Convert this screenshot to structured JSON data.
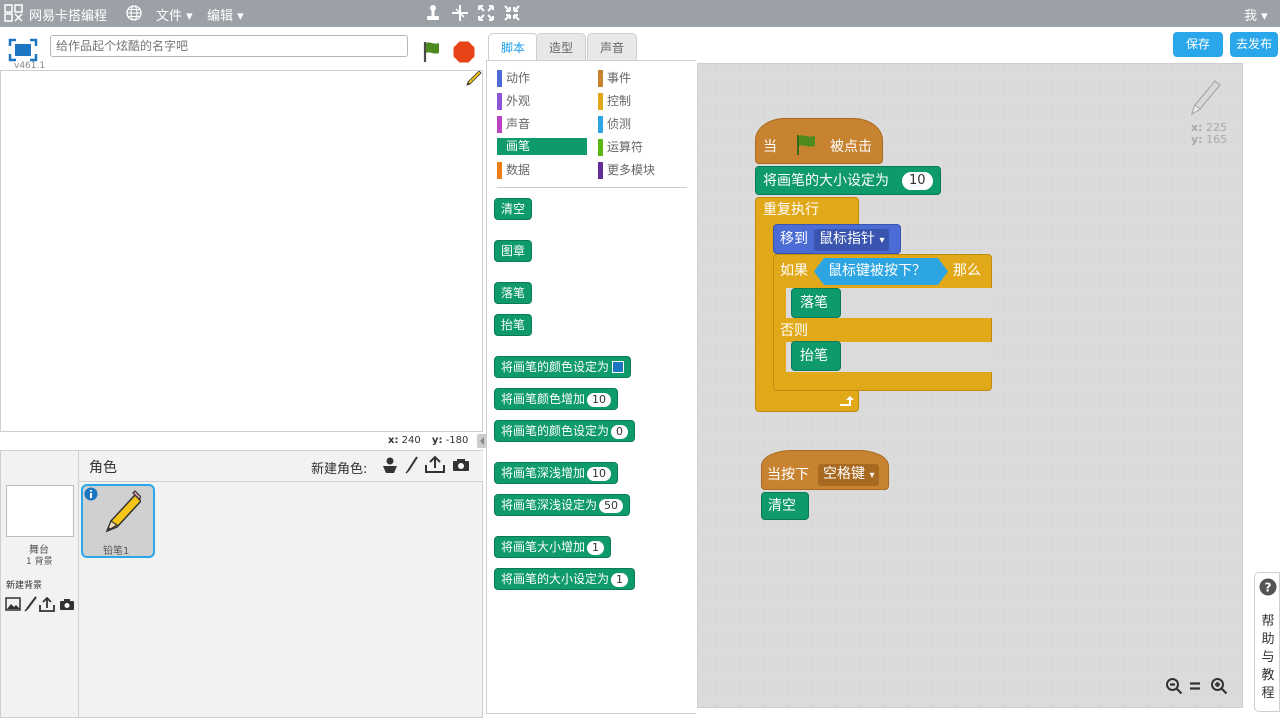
{
  "topbar": {
    "app_title": "网易卡搭编程",
    "menu_file": "文件",
    "menu_edit": "编辑",
    "user": "我"
  },
  "stage": {
    "version": "v461.1",
    "title_placeholder": "给作品起个炫酷的名字吧",
    "coord_x_label": "x:",
    "coord_x": "240",
    "coord_y_label": "y:",
    "coord_y": "-180"
  },
  "sprites": {
    "header": "角色",
    "new_sprite": "新建角色:",
    "stage_label": "舞台",
    "stage_backdrops": "1 背景",
    "new_backdrop": "新建背景",
    "sprite_name": "铅笔1"
  },
  "tabs": [
    "脚本",
    "造型",
    "声音"
  ],
  "actions": {
    "save": "保存",
    "publish": "去发布"
  },
  "categories": [
    {
      "label": "动作",
      "color": "#4a6cd4"
    },
    {
      "label": "事件",
      "color": "#c88330"
    },
    {
      "label": "外观",
      "color": "#8a55d7"
    },
    {
      "label": "控制",
      "color": "#e1a91a"
    },
    {
      "label": "声音",
      "color": "#bb42c3"
    },
    {
      "label": "侦测",
      "color": "#2ca5e2"
    },
    {
      "label": "画笔",
      "color": "#0e9a6c"
    },
    {
      "label": "运算符",
      "color": "#5cb712"
    },
    {
      "label": "数据",
      "color": "#ee7d16"
    },
    {
      "label": "更多模块",
      "color": "#632d99"
    }
  ],
  "palette_blocks": [
    {
      "text": "清空"
    },
    {
      "text": "图章"
    },
    {
      "text": "落笔"
    },
    {
      "text": "抬笔"
    },
    {
      "text": "将画笔的颜色设定为"
    },
    {
      "text": "将画笔颜色增加",
      "value": "10"
    },
    {
      "text": "将画笔的颜色设定为",
      "value": "0"
    },
    {
      "text": "将画笔深浅增加",
      "value": "10"
    },
    {
      "text": "将画笔深浅设定为",
      "value": "50"
    },
    {
      "text": "将画笔大小增加",
      "value": "1"
    },
    {
      "text": "将画笔的大小设定为",
      "value": "1"
    }
  ],
  "script1": {
    "hat_when": "当",
    "hat_clicked": "被点击",
    "set_size": "将画笔的大小设定为",
    "set_size_value": "10",
    "forever": "重复执行",
    "goto": "移到",
    "goto_target": "鼠标指针",
    "if": "如果",
    "condition": "鼠标键被按下？",
    "then": "那么",
    "pen_down": "落笔",
    "else": "否则",
    "pen_up": "抬笔"
  },
  "script2": {
    "when_key": "当按下",
    "key": "空格键",
    "clear": "清空"
  },
  "sprite_info": {
    "x_label": "x:",
    "x": "225",
    "y_label": "y:",
    "y": "165"
  },
  "help": {
    "label": "帮助与教程"
  }
}
